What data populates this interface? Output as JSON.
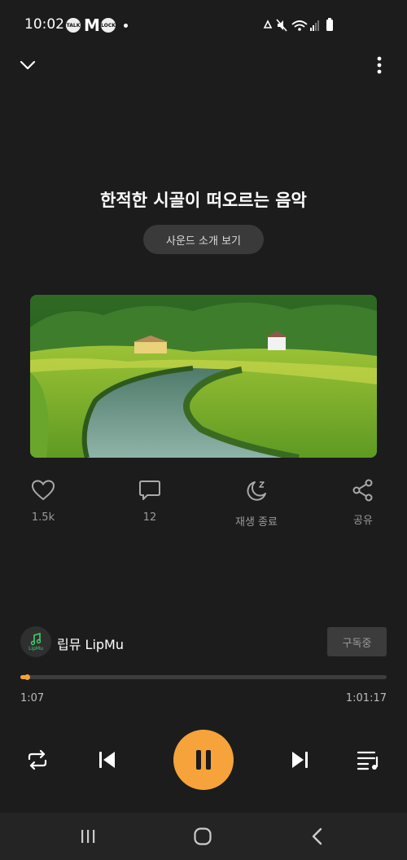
{
  "status_bar": {
    "time": "10:02",
    "talk_label": "TALK",
    "m_label": "M",
    "lock_label": "LOCK"
  },
  "player": {
    "title": "한적한 시골이 떠오르는 음악",
    "sound_intro_label": "사운드 소개 보기",
    "actions": {
      "like_count": "1.5k",
      "comment_count": "12",
      "sleep_timer_label": "재생 종료",
      "share_label": "공유"
    },
    "channel": {
      "name": "립뮤 LipMu",
      "avatar_text": "LipMu",
      "subscribe_label": "구독중"
    },
    "progress": {
      "elapsed": "1:07",
      "total": "1:01:17",
      "fraction": 0.018
    }
  },
  "colors": {
    "accent": "#f5a33a",
    "background": "#1c1c1c"
  }
}
